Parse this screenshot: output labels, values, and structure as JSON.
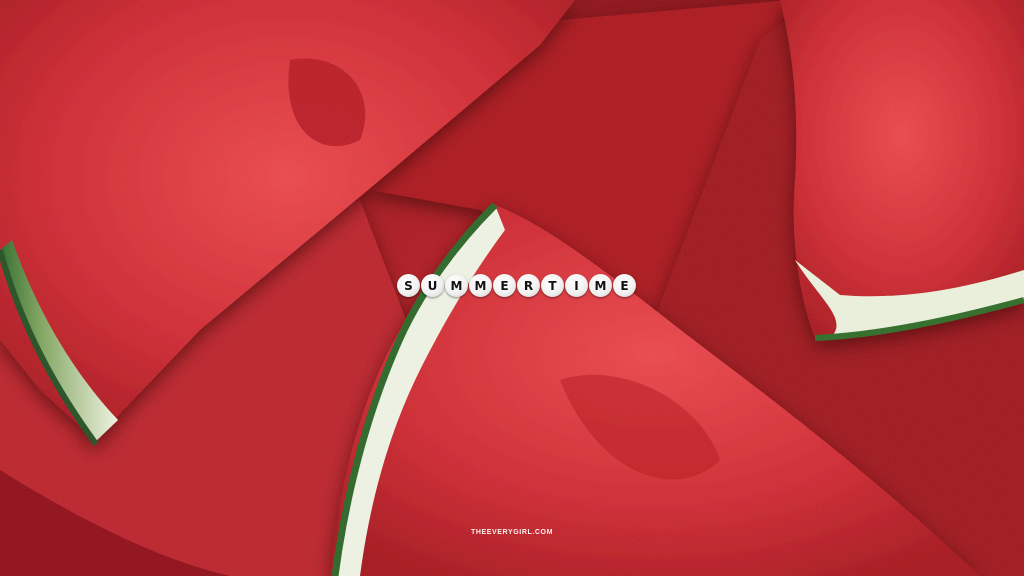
{
  "image": {
    "subject": "watermelon-slices",
    "colors": {
      "flesh_light": "#e2353a",
      "flesh_mid": "#c41f27",
      "flesh_dark": "#8d1016",
      "rind_white": "#e9f0dc",
      "rind_green": "#2f6a2a"
    }
  },
  "beads": [
    "S",
    "U",
    "M",
    "M",
    "E",
    "R",
    "T",
    "I",
    "M",
    "E"
  ],
  "watermark": "THEEVERYGIRL.COM"
}
